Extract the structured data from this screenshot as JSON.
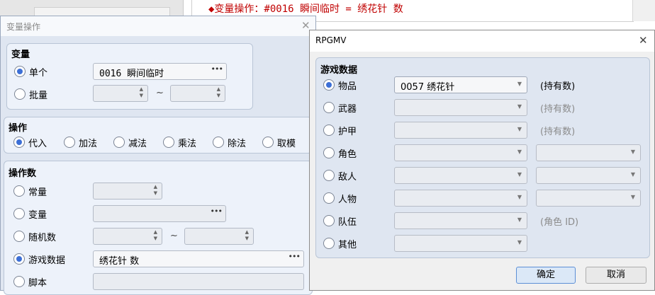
{
  "background": {
    "event_line": "◆变量操作：#0016 瞬间临时 = 绣花针 数"
  },
  "variable_dialog": {
    "title": "变量操作",
    "variable_section": {
      "label": "变量",
      "single_label": "单个",
      "single_value": "0016 瞬间临时",
      "range_label": "批量",
      "tilde": "~"
    },
    "operation_section": {
      "label": "操作",
      "options": [
        "代入",
        "加法",
        "减法",
        "乘法",
        "除法",
        "取模"
      ],
      "selected": "代入"
    },
    "operand_section": {
      "label": "操作数",
      "constant_label": "常量",
      "variable_label": "变量",
      "random_label": "随机数",
      "tilde": "~",
      "game_data_label": "游戏数据",
      "game_data_value": "绣花针 数",
      "script_label": "脚本"
    }
  },
  "game_data_dialog": {
    "title": "RPGMV",
    "group_label": "游戏数据",
    "rows": [
      {
        "label": "物品",
        "value": "0057 绣花针",
        "suffix": "(持有数)",
        "selected": true
      },
      {
        "label": "武器",
        "value": "",
        "suffix": "(持有数)",
        "selected": false
      },
      {
        "label": "护甲",
        "value": "",
        "suffix": "(持有数)",
        "selected": false
      },
      {
        "label": "角色",
        "value": "",
        "suffix": "",
        "selected": false
      },
      {
        "label": "敌人",
        "value": "",
        "suffix": "",
        "selected": false
      },
      {
        "label": "人物",
        "value": "",
        "suffix": "",
        "selected": false
      },
      {
        "label": "队伍",
        "value": "",
        "suffix": "(角色 ID)",
        "selected": false
      },
      {
        "label": "其他",
        "value": "",
        "suffix": "",
        "selected": false
      }
    ],
    "ok_label": "确定",
    "cancel_label": "取消"
  },
  "colors": {
    "accent": "#3c6fd6",
    "event_text": "#c00000",
    "panel_bg": "#edf2fa"
  }
}
